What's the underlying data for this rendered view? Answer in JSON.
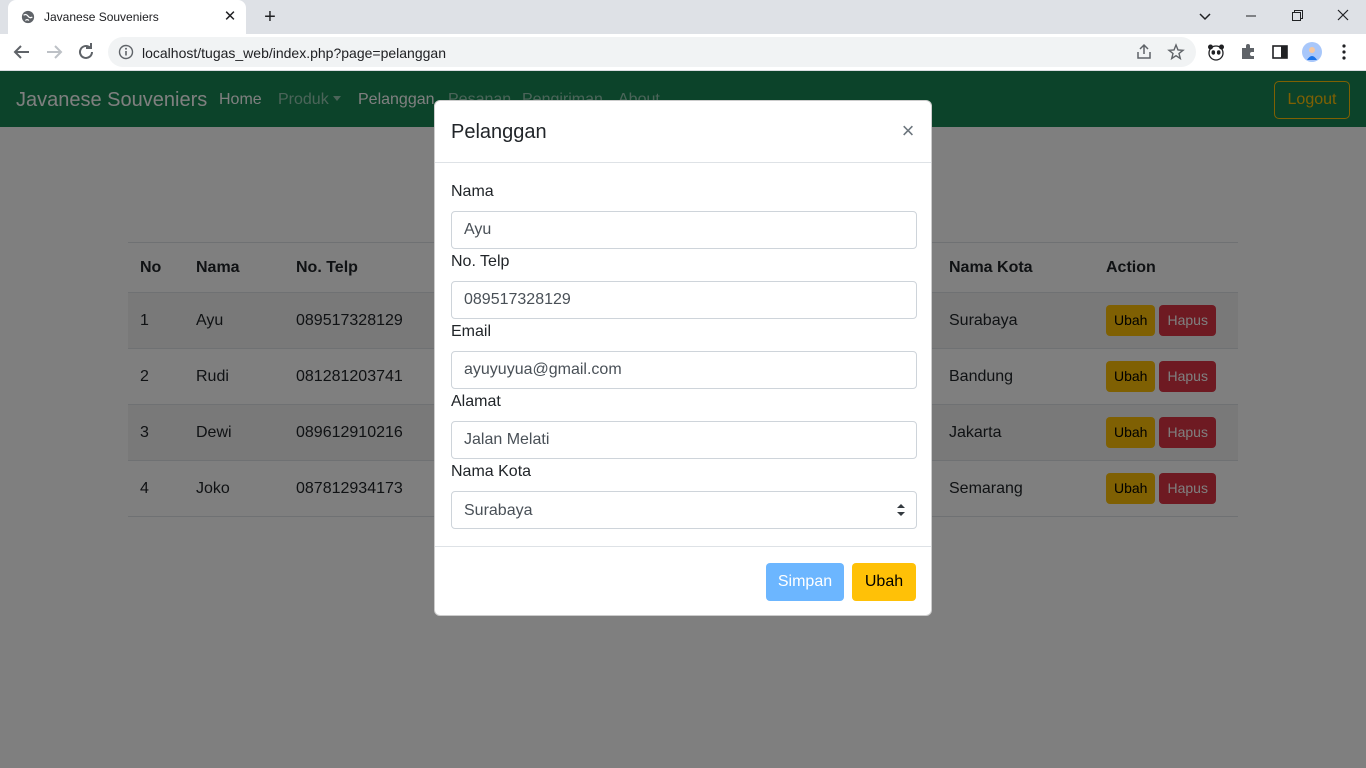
{
  "browser": {
    "tab_title": "Javanese Souveniers",
    "url": "localhost/tugas_web/index.php?page=pelanggan"
  },
  "navbar": {
    "brand": "Javanese Souveniers",
    "links": [
      "Home",
      "Produk",
      "Pelanggan",
      "Pesanan",
      "Pengiriman",
      "About"
    ],
    "logout": "Logout"
  },
  "table": {
    "headers": [
      "No",
      "Nama",
      "No. Telp",
      "Nama Kota",
      "Action"
    ],
    "rows": [
      {
        "no": "1",
        "nama": "Ayu",
        "telp": "089517328129",
        "kota": "Surabaya"
      },
      {
        "no": "2",
        "nama": "Rudi",
        "telp": "081281203741",
        "kota": "Bandung"
      },
      {
        "no": "3",
        "nama": "Dewi",
        "telp": "089612910216",
        "kota": "Jakarta"
      },
      {
        "no": "4",
        "nama": "Joko",
        "telp": "087812934173",
        "kota": "Semarang"
      }
    ],
    "edit_label": "Ubah",
    "delete_label": "Hapus"
  },
  "modal": {
    "title": "Pelanggan",
    "close": "×",
    "fields": {
      "nama": {
        "label": "Nama",
        "value": "Ayu"
      },
      "telp": {
        "label": "No. Telp",
        "value": "089517328129"
      },
      "email": {
        "label": "Email",
        "value": "ayuyuyua@gmail.com"
      },
      "alamat": {
        "label": "Alamat",
        "value": "Jalan Melati"
      },
      "kota": {
        "label": "Nama Kota",
        "value": "Surabaya"
      }
    },
    "simpan": "Simpan",
    "ubah": "Ubah"
  },
  "colors": {
    "navbar": "#198754",
    "warning": "#ffc107",
    "danger": "#dc3545",
    "primary_light": "#6cb6ff"
  }
}
